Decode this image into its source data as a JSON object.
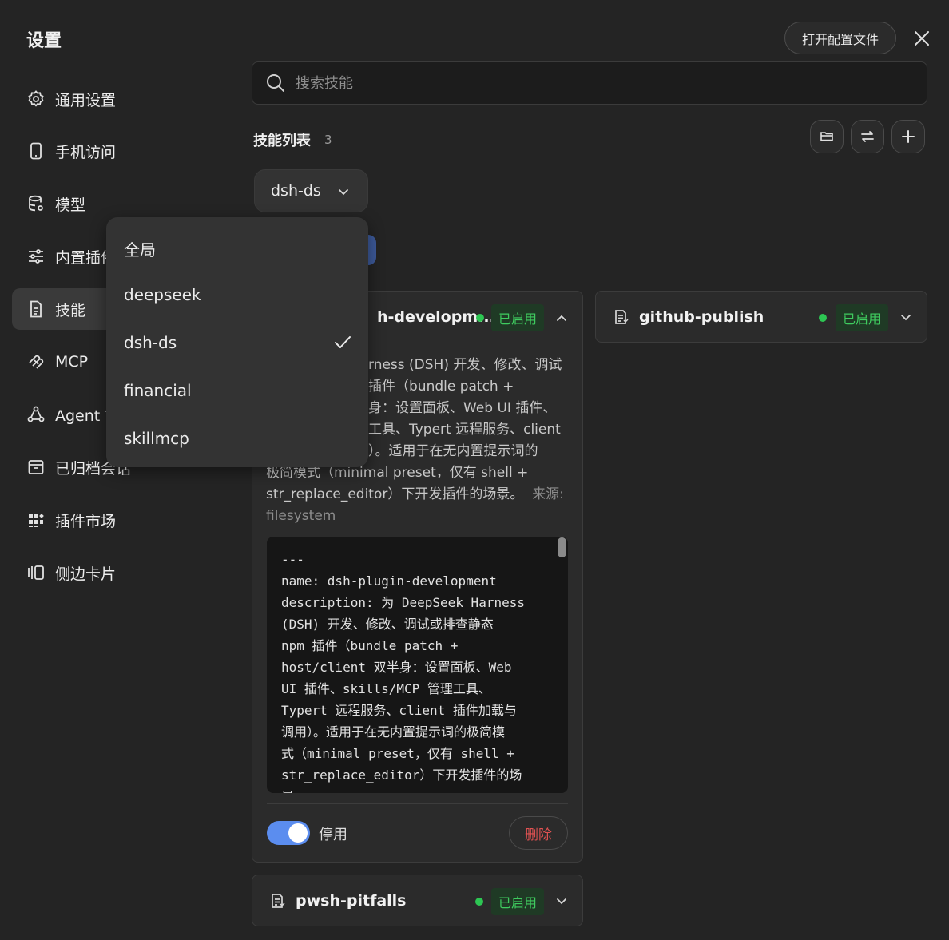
{
  "header": {
    "title": "设置",
    "open_config_label": "打开配置文件"
  },
  "sidebar": {
    "items": [
      {
        "label": "通用设置",
        "icon": "gear-icon"
      },
      {
        "label": "手机访问",
        "icon": "phone-icon"
      },
      {
        "label": "模型",
        "icon": "database-icon"
      },
      {
        "label": "内置插件",
        "icon": "sliders-icon"
      },
      {
        "label": "技能",
        "icon": "document-icon",
        "active": true
      },
      {
        "label": "MCP",
        "icon": "mcp-icon"
      },
      {
        "label": "Agent 管理",
        "icon": "agent-icon"
      },
      {
        "label": "已归档会话",
        "icon": "archive-icon"
      },
      {
        "label": "插件市场",
        "icon": "grid-icon"
      },
      {
        "label": "侧边卡片",
        "icon": "side-card-icon"
      }
    ]
  },
  "search": {
    "placeholder": "搜索技能",
    "value": ""
  },
  "skills_list": {
    "title": "技能列表",
    "count": "3"
  },
  "filter": {
    "selected": "dsh-ds",
    "options": [
      "全局",
      "deepseek",
      "dsh-ds",
      "financial",
      "skillmcp"
    ]
  },
  "cards": {
    "dsh": {
      "name": "dsh-plugin-development",
      "name_visible": "h-developm...",
      "status": "已启用",
      "description": "rness (DSH) 开发、修改、调试 插件（bundle patch + 身：设置面板、Web UI 插件、 工具、Typert 远程服务、client ）。适用于在无内置提示词的 极简模式（minimal preset，仅有 shell + str_replace_editor）下开发插件的场景。",
      "desc_lines": [
        "rness (DSH) 开发、修改、调试",
        "插件（bundle patch +",
        "身：设置面板、Web UI 插件、",
        "工具、Typert 远程服务、client",
        "）。适用于在无内置提示词的",
        "极简模式（minimal preset，仅有 shell +",
        "str_replace_editor）下开发插件的场景。"
      ],
      "source_label": "来源:",
      "source_value": "filesystem",
      "code": "---\nname: dsh-plugin-development\ndescription: 为 DeepSeek Harness\n(DSH) 开发、修改、调试或排查静态\nnpm 插件（bundle patch +\nhost/client 双半身：设置面板、Web\nUI 插件、skills/MCP 管理工具、\nTypert 远程服务、client 插件加载与\n调用）。适用于在无内置提示词的极简模\n式（minimal preset，仅有 shell +\nstr_replace_editor）下开发插件的场\n景。",
      "toggle_label": "停用",
      "toggle_on": true,
      "delete_label": "删除"
    },
    "github": {
      "name": "github-publish",
      "status": "已启用"
    },
    "pwsh": {
      "name": "pwsh-pitfalls",
      "status": "已启用"
    }
  },
  "colors": {
    "background": "#242424",
    "enabled_green": "#2dc653",
    "toggle_blue": "#5b8def",
    "delete_red": "#e05252"
  }
}
